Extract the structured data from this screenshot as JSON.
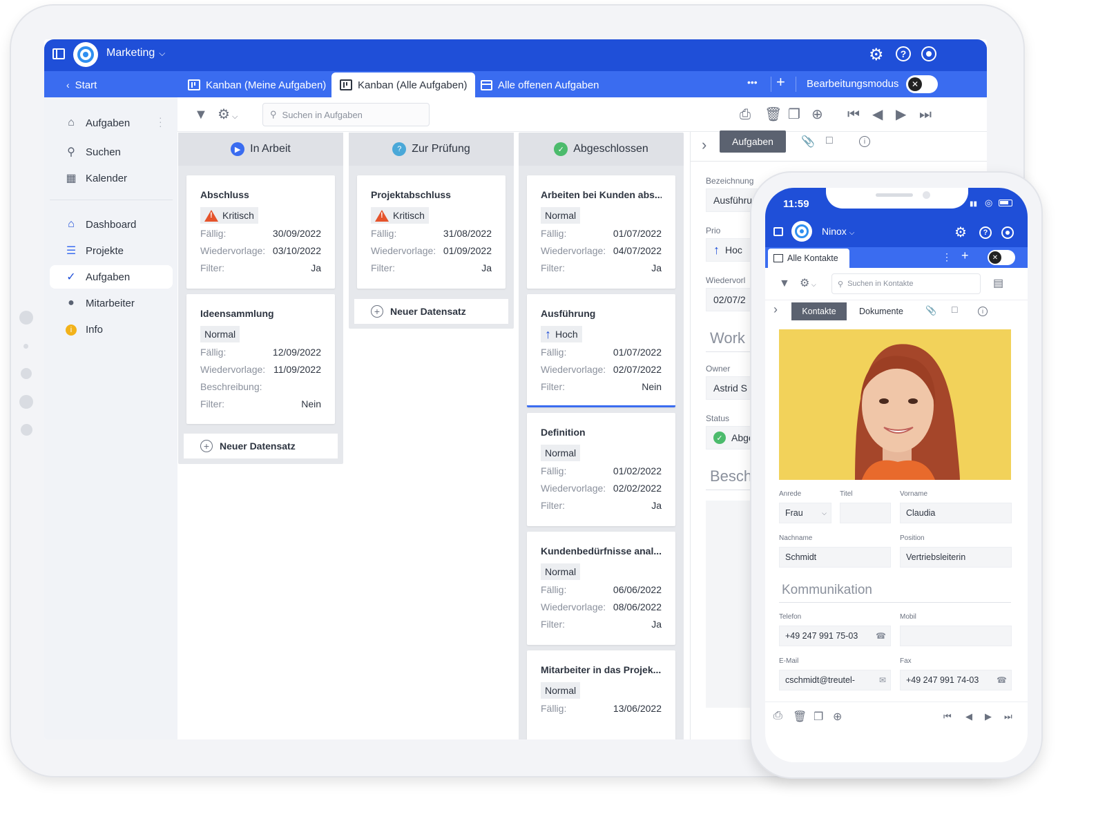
{
  "app": {
    "workspace": "Marketing",
    "back_label": "Start",
    "tabs": [
      {
        "label": "Kanban (Meine Aufgaben)"
      },
      {
        "label": "Kanban (Alle Aufgaben)"
      },
      {
        "label": "Alle offenen Aufgaben"
      }
    ],
    "more": "•••",
    "add": "+",
    "edit_mode_label": "Bearbeitungsmodus"
  },
  "sidebar": {
    "items": [
      {
        "label": "Aufgaben",
        "icon": "home-icon"
      },
      {
        "label": "Suchen",
        "icon": "search-icon"
      },
      {
        "label": "Kalender",
        "icon": "calendar-icon"
      },
      {
        "label": "Dashboard",
        "icon": "home-icon"
      },
      {
        "label": "Projekte",
        "icon": "list-icon"
      },
      {
        "label": "Aufgaben",
        "icon": "checklist-icon"
      },
      {
        "label": "Mitarbeiter",
        "icon": "person-icon"
      },
      {
        "label": "Info",
        "icon": "info-icon"
      }
    ]
  },
  "toolbar": {
    "search_placeholder": "Suchen in Aufgaben"
  },
  "kanban": {
    "columns": [
      {
        "title": "In Arbeit",
        "color": "#3a6cf0",
        "cards": [
          {
            "title": "Abschluss",
            "priority": "Kritisch",
            "faellig": "30/09/2022",
            "wiedervorlage": "03/10/2022",
            "filter": "Ja"
          },
          {
            "title": "Ideensammlung",
            "priority": "Normal",
            "faellig": "12/09/2022",
            "wiedervorlage": "11/09/2022",
            "beschreibung": "",
            "filter": "Nein"
          }
        ],
        "new_label": "Neuer Datensatz"
      },
      {
        "title": "Zur Prüfung",
        "color": "#4aa8d8",
        "cards": [
          {
            "title": "Projektabschluss",
            "priority": "Kritisch",
            "faellig": "31/08/2022",
            "wiedervorlage": "01/09/2022",
            "filter": "Ja"
          }
        ],
        "new_label": "Neuer Datensatz"
      },
      {
        "title": "Abgeschlossen",
        "color": "#4cbb6c",
        "cards": [
          {
            "title": "Arbeiten bei Kunden abs...",
            "priority": "Normal",
            "faellig": "01/07/2022",
            "wiedervorlage": "04/07/2022",
            "filter": "Ja"
          },
          {
            "title": "Ausführung",
            "priority": "Hoch",
            "faellig": "01/07/2022",
            "wiedervorlage": "02/07/2022",
            "filter": "Nein"
          },
          {
            "title": "Definition",
            "priority": "Normal",
            "faellig": "01/02/2022",
            "wiedervorlage": "02/02/2022",
            "filter": "Ja"
          },
          {
            "title": "Kundenbedürfnisse anal...",
            "priority": "Normal",
            "faellig": "06/06/2022",
            "wiedervorlage": "08/06/2022",
            "filter": "Ja"
          },
          {
            "title": "Mitarbeiter in das Projek...",
            "priority": "Normal",
            "faellig": "13/06/2022"
          }
        ]
      }
    ],
    "labels": {
      "faellig": "Fällig:",
      "wiedervorlage": "Wiedervorlage:",
      "filter": "Filter:",
      "beschreibung": "Beschreibung:"
    }
  },
  "detail": {
    "tab_active": "Aufgaben",
    "fields": {
      "bezeichnung_label": "Bezeichnung",
      "bezeichnung_value": "Ausführu",
      "prio_label": "Prio",
      "prio_value": "Hoc",
      "wiedervorlage_label": "Wiedervorl",
      "wiedervorlage_value": "02/07/2",
      "section_work": "Work",
      "owner_label": "Owner",
      "owner_value": "Astrid S",
      "status_label": "Status",
      "status_value": "Abge",
      "section_besch": "Besch"
    }
  },
  "phone": {
    "time": "11:59",
    "workspace": "Ninox",
    "tab": "Alle Kontakte",
    "search_placeholder": "Suchen in Kontakte",
    "tabs": [
      "Kontakte",
      "Dokumente"
    ],
    "fields": {
      "anrede_label": "Anrede",
      "anrede_value": "Frau",
      "titel_label": "Titel",
      "titel_value": "",
      "vorname_label": "Vorname",
      "vorname_value": "Claudia",
      "nachname_label": "Nachname",
      "nachname_value": "Schmidt",
      "position_label": "Position",
      "position_value": "Vertriebsleiterin",
      "section": "Kommunikation",
      "telefon_label": "Telefon",
      "telefon_value": "+49 247 991 75-03",
      "mobil_label": "Mobil",
      "mobil_value": "",
      "email_label": "E-Mail",
      "email_value": "cschmidt@treutel-",
      "fax_label": "Fax",
      "fax_value": "+49 247 991 74-03"
    }
  }
}
